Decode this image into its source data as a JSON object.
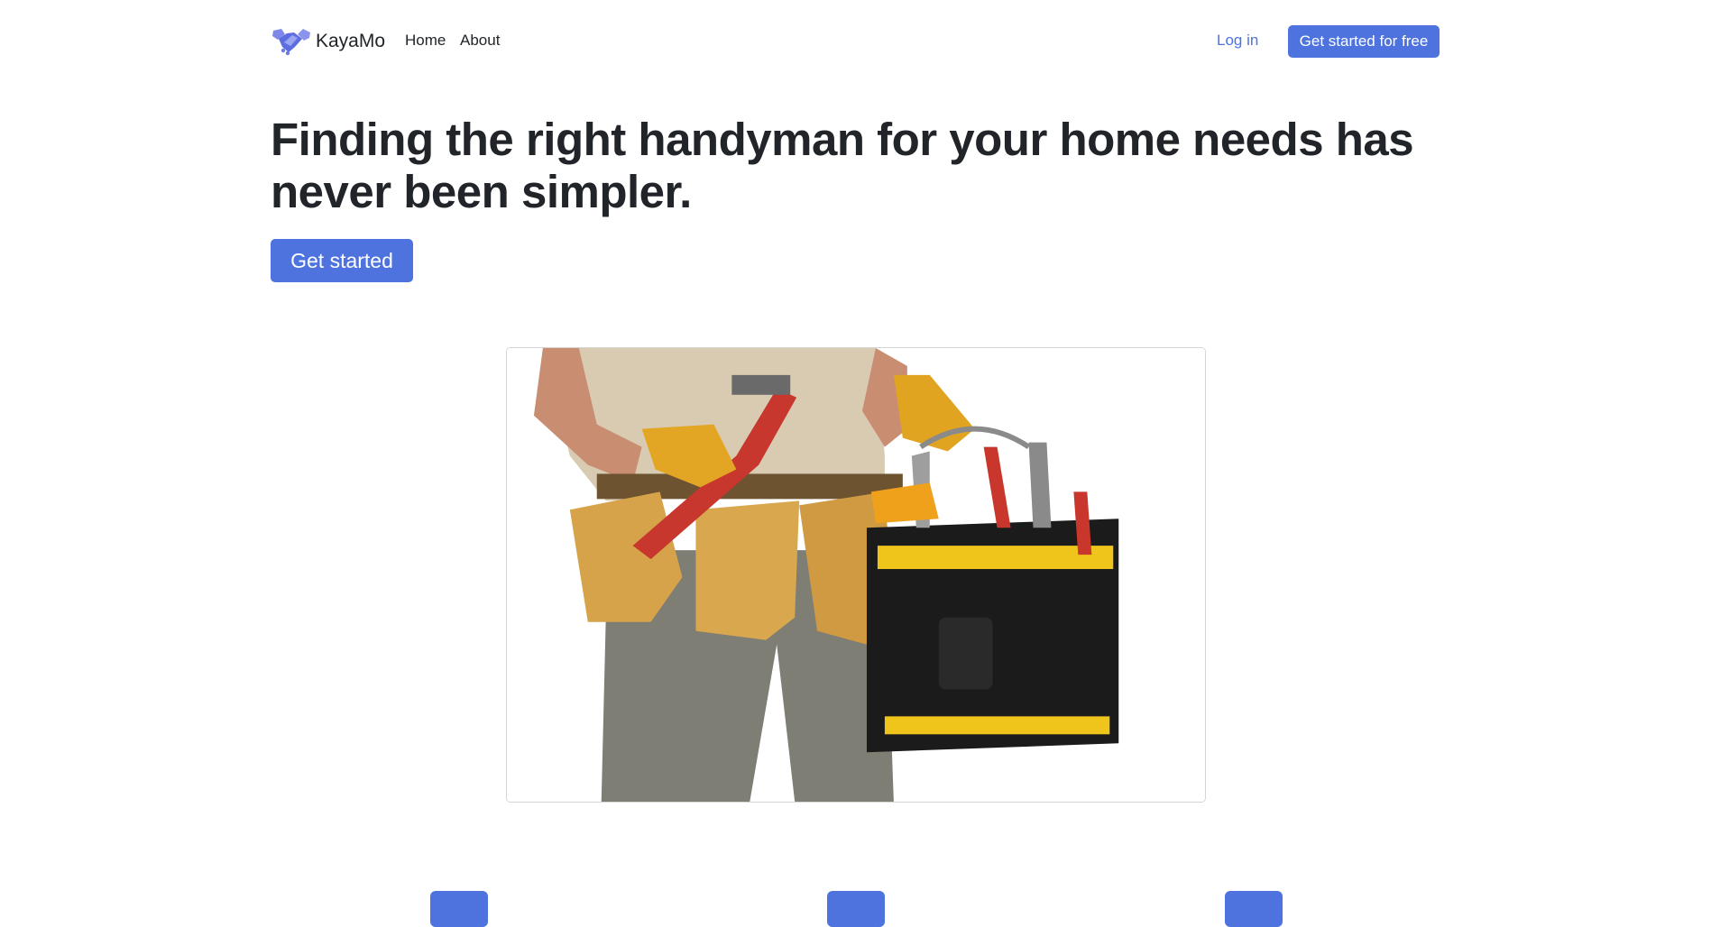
{
  "navbar": {
    "brand": "KayaMo",
    "brand_icon": "handshake-icon",
    "links": [
      "Home",
      "About"
    ],
    "login_label": "Log in",
    "cta_label": "Get started for free"
  },
  "hero": {
    "title": "Finding the right handyman for your home needs has never been simpler.",
    "button_label": "Get started",
    "image_subject": "handyman-with-tool-belt-and-tool-bag"
  },
  "features": {
    "icons": [
      "feature-icon",
      "feature-icon",
      "feature-icon"
    ]
  },
  "colors": {
    "primary": "#4e73df",
    "text": "#212529",
    "background": "#ffffff"
  }
}
